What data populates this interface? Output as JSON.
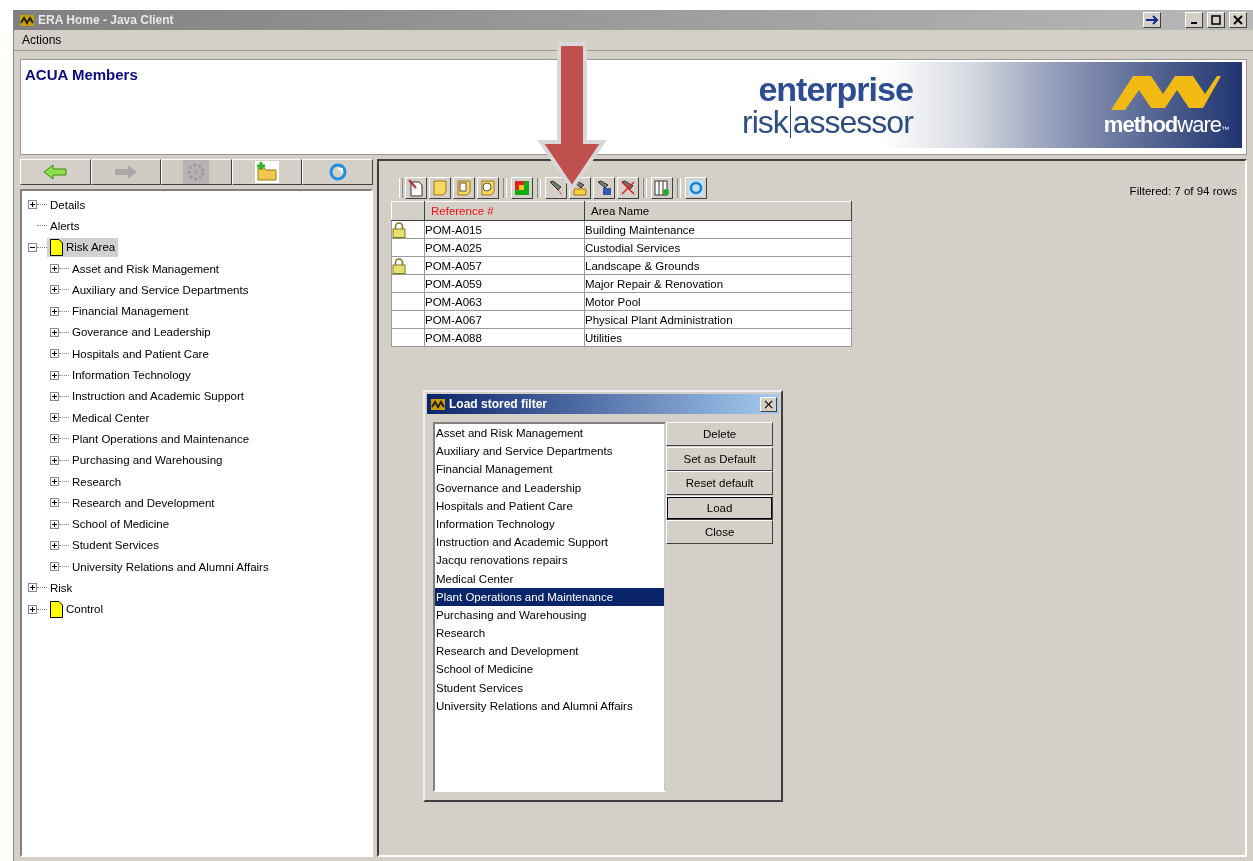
{
  "window": {
    "title": "ERA Home - Java Client"
  },
  "menu": [
    "Actions"
  ],
  "header": {
    "title": "ACUA Members",
    "logo": {
      "line_1": "enterprise",
      "line_2a": "risk",
      "line_2b": "assessor",
      "brand_a": "method",
      "brand_b": "ware",
      "tm": "™"
    }
  },
  "nav_buttons": [
    {
      "kind": "back",
      "disabled": false
    },
    {
      "kind": "forward",
      "disabled": true
    },
    {
      "kind": "gear",
      "disabled": true
    },
    {
      "kind": "new-folder",
      "disabled": false
    },
    {
      "kind": "refresh",
      "disabled": false
    }
  ],
  "tree": [
    {
      "label": "Details",
      "expanded": false,
      "icon": false,
      "selected": false
    },
    {
      "label": "Alerts",
      "icon": false,
      "selected": false
    },
    {
      "label": "Risk Area",
      "expanded": true,
      "icon": true,
      "selected": true,
      "children": [
        {
          "label": "Asset and Risk Management",
          "expanded": false,
          "icon": false,
          "selected": false
        },
        {
          "label": "Auxiliary and Service Departments",
          "expanded": false,
          "icon": false,
          "selected": false
        },
        {
          "label": "Financial Management",
          "expanded": false,
          "icon": false,
          "selected": false
        },
        {
          "label": "Goverance and Leadership",
          "expanded": false,
          "icon": false,
          "selected": false
        },
        {
          "label": "Hospitals and Patient Care",
          "expanded": false,
          "icon": false,
          "selected": false
        },
        {
          "label": "Information Technology",
          "expanded": false,
          "icon": false,
          "selected": false
        },
        {
          "label": "Instruction and Academic Support",
          "expanded": false,
          "icon": false,
          "selected": false
        },
        {
          "label": "Medical Center",
          "expanded": false,
          "icon": false,
          "selected": false
        },
        {
          "label": "Plant Operations and Maintenance",
          "expanded": false,
          "icon": false,
          "selected": false
        },
        {
          "label": "Purchasing and Warehousing",
          "expanded": false,
          "icon": false,
          "selected": false
        },
        {
          "label": "Research",
          "expanded": false,
          "icon": false,
          "selected": false
        },
        {
          "label": "Research and Development",
          "expanded": false,
          "icon": false,
          "selected": false
        },
        {
          "label": "School of Medicine",
          "expanded": false,
          "icon": false,
          "selected": false
        },
        {
          "label": "Student Services",
          "expanded": false,
          "icon": false,
          "selected": false
        },
        {
          "label": "University Relations and Alumni Affairs",
          "expanded": false,
          "icon": false,
          "selected": false
        }
      ]
    },
    {
      "label": "Risk",
      "expanded": false,
      "icon": false,
      "selected": false
    },
    {
      "label": "Control",
      "expanded": false,
      "icon": true,
      "selected": false
    }
  ],
  "filter_status": "Filtered: 7 of 94 rows",
  "table": {
    "columns": [
      {
        "label": "Reference #",
        "sorted": true
      },
      {
        "label": "Area Name",
        "sorted": false
      }
    ],
    "rows": [
      {
        "locked": true,
        "reference": "POM-A015",
        "area": "Building Maintenance"
      },
      {
        "locked": false,
        "reference": "POM-A025",
        "area": "Custodial Services"
      },
      {
        "locked": true,
        "reference": "POM-A057",
        "area": "Landscape & Grounds"
      },
      {
        "locked": false,
        "reference": "POM-A059",
        "area": "Major Repair & Renovation"
      },
      {
        "locked": false,
        "reference": "POM-A063",
        "area": "Motor Pool"
      },
      {
        "locked": false,
        "reference": "POM-A067",
        "area": "Physical Plant Administration"
      },
      {
        "locked": false,
        "reference": "POM-A088",
        "area": "Utilities"
      }
    ]
  },
  "dialog": {
    "title": "Load stored filter",
    "close": "×",
    "filters": [
      {
        "label": "Asset and Risk Management",
        "selected": false
      },
      {
        "label": "Auxiliary and Service Departments",
        "selected": false
      },
      {
        "label": "Financial Management",
        "selected": false
      },
      {
        "label": "Governance and Leadership",
        "selected": false
      },
      {
        "label": "Hospitals and Patient Care",
        "selected": false
      },
      {
        "label": "Information Technology",
        "selected": false
      },
      {
        "label": "Instruction and Academic Support",
        "selected": false
      },
      {
        "label": "Jacqu renovations repairs",
        "selected": false
      },
      {
        "label": "Medical Center",
        "selected": false
      },
      {
        "label": "Plant Operations and Maintenance",
        "selected": true
      },
      {
        "label": "Purchasing and Warehousing",
        "selected": false
      },
      {
        "label": "Research",
        "selected": false
      },
      {
        "label": "Research and Development",
        "selected": false
      },
      {
        "label": "School of Medicine",
        "selected": false
      },
      {
        "label": "Student Services",
        "selected": false
      },
      {
        "label": "University Relations and Alumni Affairs",
        "selected": false
      }
    ],
    "buttons": [
      {
        "label": "Delete",
        "default": false
      },
      {
        "label": "Set as Default",
        "default": false
      },
      {
        "label": "Reset default",
        "default": false
      },
      {
        "label": "Load",
        "default": true
      },
      {
        "label": "Close",
        "default": false
      }
    ]
  }
}
